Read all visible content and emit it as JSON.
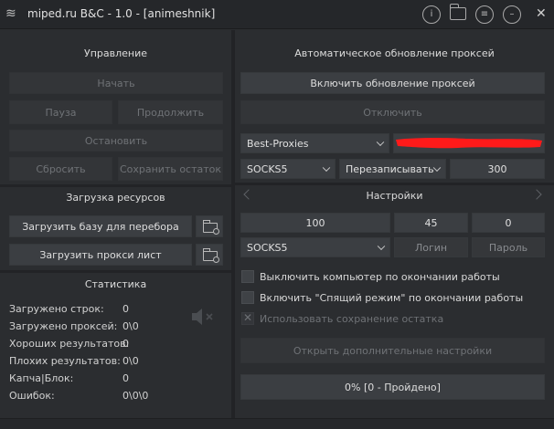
{
  "window": {
    "title": "miped.ru B&C - 1.0 - [animeshnik]"
  },
  "control": {
    "title": "Управление",
    "start": "Начать",
    "pause": "Пауза",
    "continue": "Продолжить",
    "stop": "Остановить",
    "reset": "Сбросить",
    "save_rest": "Сохранить остаток"
  },
  "resources": {
    "title": "Загрузка ресурсов",
    "load_base": "Загрузить базу для перебора",
    "load_proxy": "Загрузить прокси лист"
  },
  "stats": {
    "title": "Статистика",
    "rows": [
      {
        "label": "Загружено строк:",
        "value": "0"
      },
      {
        "label": "Загружено проксей:",
        "value": "0\\0"
      },
      {
        "label": "Хороших результатов:",
        "value": "0"
      },
      {
        "label": "Плохих результатов:",
        "value": "0\\0"
      },
      {
        "label": "Капча|Блок:",
        "value": "0"
      },
      {
        "label": "Ошибок:",
        "value": "0\\0\\0"
      }
    ]
  },
  "proxy_update": {
    "title": "Автоматическое обновление проксей",
    "enable": "Включить обновление проксей",
    "disable": "Отключить",
    "source": "Best-Proxies",
    "type": "SOCKS5",
    "mode": "Перезаписывать",
    "interval": "300"
  },
  "settings": {
    "title": "Настройки",
    "threads": "100",
    "timeout": "45",
    "retries": "0",
    "proxy_type": "SOCKS5",
    "login": "Логин",
    "password": "Пароль",
    "shutdown_label": "Выключить компьютер по окончании работы",
    "sleep_label": "Включить \"Спящий режим\" по окончании работы",
    "save_rest_label": "Использовать сохранение остатка",
    "advanced": "Открыть дополнительные настройки",
    "progress": "0% [0 - Пройдено]"
  },
  "icons": {
    "app": "app-icon",
    "info": "info-icon",
    "folder": "folder-icon",
    "menu": "menu-icon",
    "minimize": "minimize-icon",
    "close": "close-icon",
    "speaker": "speaker-muted-icon"
  },
  "colors": {
    "redaction": "#ff1a1a"
  }
}
